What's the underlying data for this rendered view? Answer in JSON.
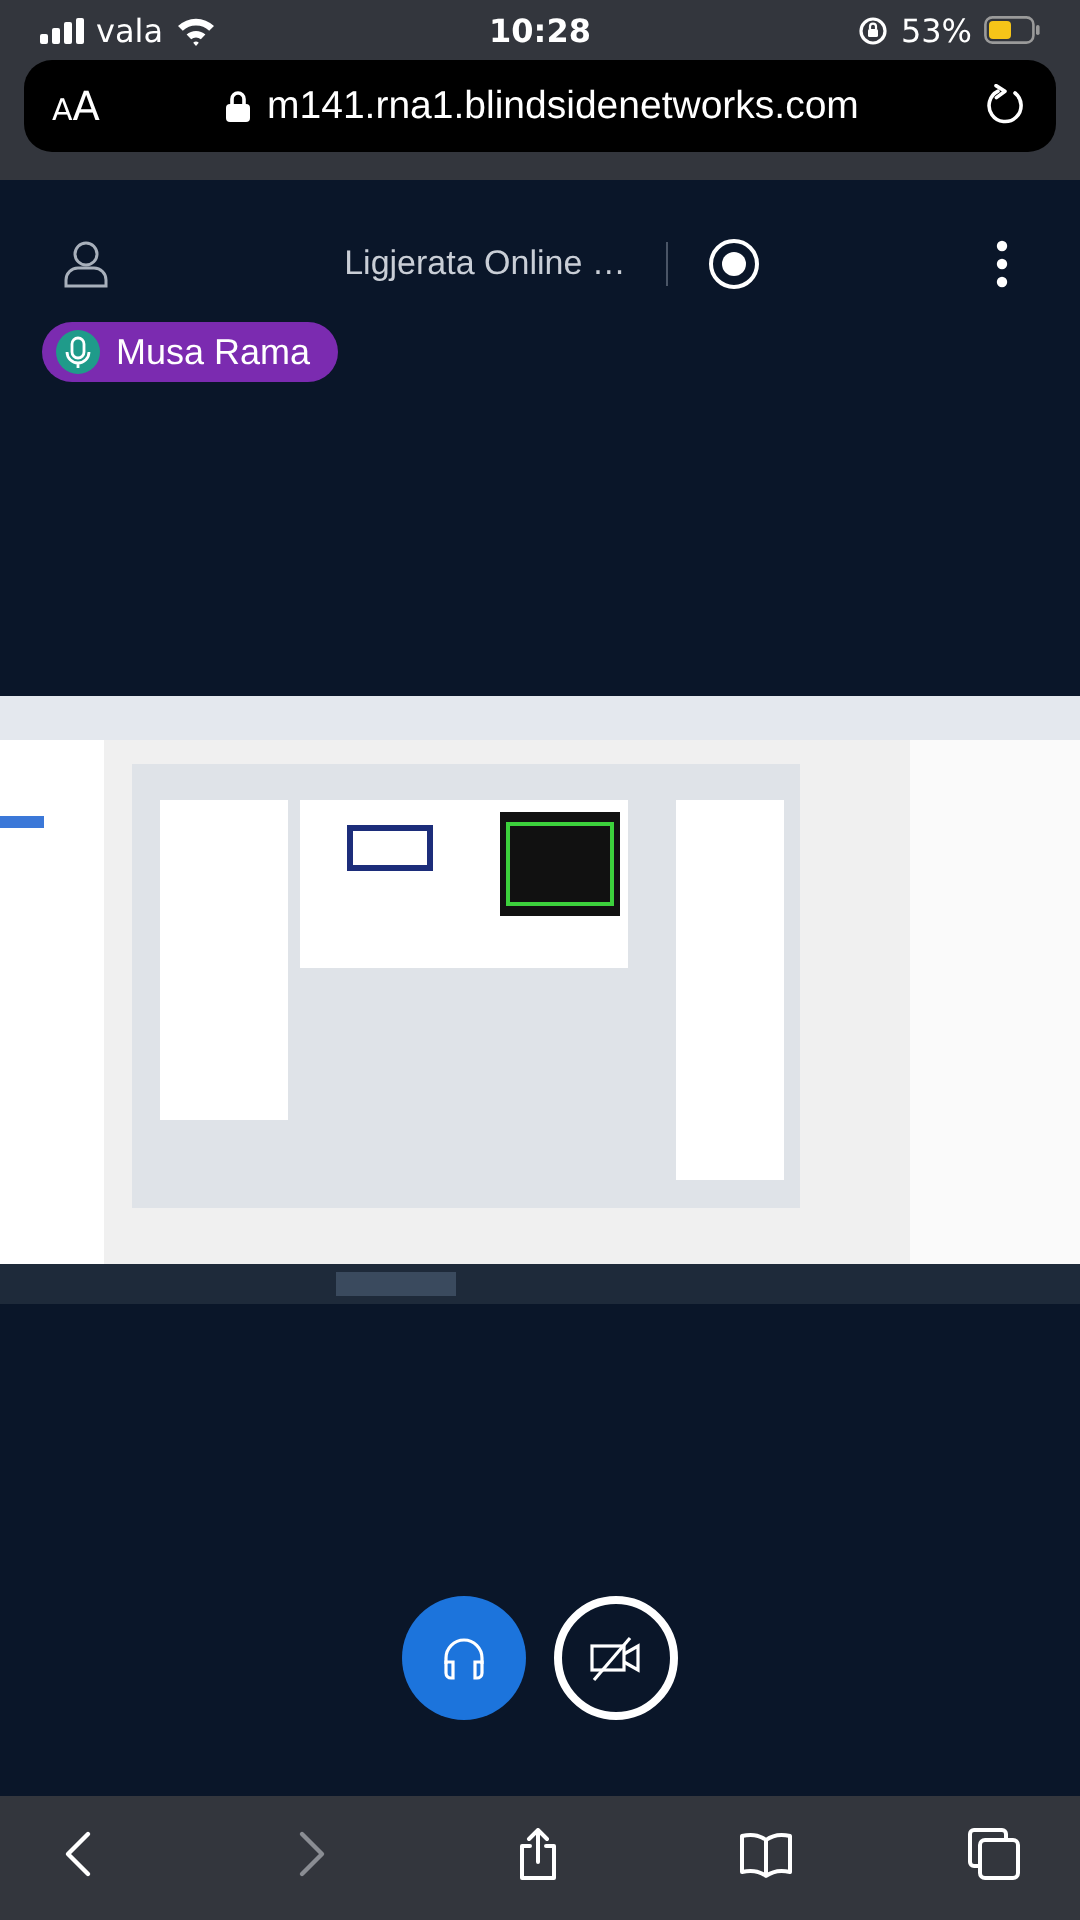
{
  "status_bar": {
    "carrier": "vala",
    "time": "10:28",
    "battery": "53%"
  },
  "address_bar": {
    "text_size_button": "AA",
    "url": "m141.rna1.blindsidenetworks.com"
  },
  "meeting_header": {
    "title": "Ligjerata Online …",
    "recording": true
  },
  "talking_indicator": {
    "name": "Musa Rama"
  },
  "media_controls": [
    {
      "kind": "audio",
      "on": true
    },
    {
      "kind": "video",
      "on": false
    }
  ],
  "browser_toolbar": [
    {
      "kind": "back",
      "disabled": false
    },
    {
      "kind": "forward",
      "disabled": true
    },
    {
      "kind": "share",
      "disabled": false
    },
    {
      "kind": "bookmarks",
      "disabled": false
    },
    {
      "kind": "tabs",
      "disabled": false
    }
  ]
}
